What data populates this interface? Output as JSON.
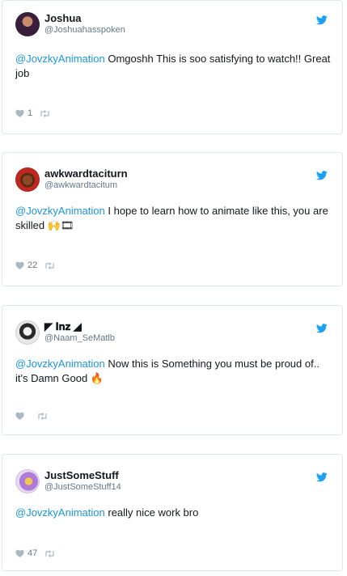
{
  "colors": {
    "accent": "#1da1f2",
    "mention": "#1b95e0",
    "muted": "#657786",
    "border": "#e1e8ed"
  },
  "tweets": [
    {
      "name": "Joshua",
      "handle": "@Joshuahasspoken",
      "mention": "@JovzkyAnimation",
      "text": " Omgoshh This is soo satisfying to watch!! Great job",
      "likes": "1",
      "avatar_icon": "profile-photo"
    },
    {
      "name": "awkwardtaciturn",
      "handle": "@awkwardtacitum",
      "mention": "@JovzkyAnimation",
      "text": " I hope to learn how to animate like this, you are skilled 🙌🎞",
      "likes": "22",
      "avatar_icon": "profile-photo"
    },
    {
      "name": "◤ 𝐈𝐧𝐳 ◢",
      "handle": "@Naam_SeMatlb",
      "mention": "@JovzkyAnimation",
      "text": " Now this is Something you must be proud of.. it's Damn Good 🔥",
      "likes": "",
      "avatar_icon": "profile-photo"
    },
    {
      "name": "JustSomeStuff",
      "handle": "@JustSomeStuff14",
      "mention": "@JovzkyAnimation",
      "text": " really nice work bro",
      "likes": "47",
      "avatar_icon": "profile-photo"
    }
  ]
}
